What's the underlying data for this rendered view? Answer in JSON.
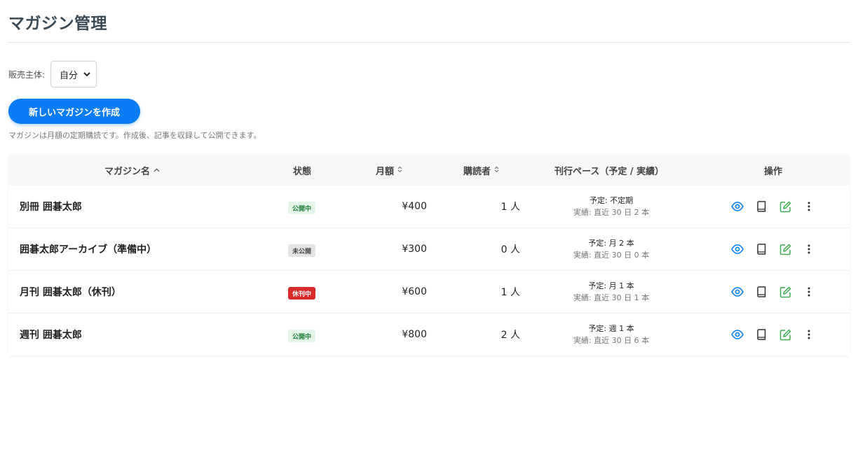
{
  "page": {
    "title": "マガジン管理"
  },
  "seller": {
    "label": "販売主体:",
    "selected": "自分"
  },
  "actions": {
    "create_label": "新しいマガジンを作成",
    "help_text": "マガジンは月額の定期購読です。作成後、記事を収録して公開できます。"
  },
  "table": {
    "headers": {
      "name": "マガジン名",
      "status": "状態",
      "price": "月額",
      "subscribers": "購読者",
      "pace": "刊行ペース（予定 / 実績）",
      "ops": "操作"
    },
    "rows": [
      {
        "name": "別冊 囲碁太郎",
        "status": "公開中",
        "status_kind": "published",
        "price": "¥400",
        "subscribers": "1 人",
        "plan": "予定: 不定期",
        "actual": "実績: 直近 30 日 2 本"
      },
      {
        "name": "囲碁太郎アーカイブ（準備中）",
        "status": "未公開",
        "status_kind": "draft",
        "price": "¥300",
        "subscribers": "0 人",
        "plan": "予定: 月 2 本",
        "actual": "実績: 直近 30 日 0 本"
      },
      {
        "name": "月刊 囲碁太郎（休刊）",
        "status": "休刊中",
        "status_kind": "paused",
        "price": "¥600",
        "subscribers": "1 人",
        "plan": "予定: 月 1 本",
        "actual": "実績: 直近 30 日 1 本"
      },
      {
        "name": "週刊 囲碁太郎",
        "status": "公開中",
        "status_kind": "published",
        "price": "¥800",
        "subscribers": "2 人",
        "plan": "予定: 週 1 本",
        "actual": "実績: 直近 30 日 6 本"
      }
    ],
    "row_actions": [
      "eye-icon",
      "book-icon",
      "edit-icon",
      "more-vertical-icon"
    ]
  },
  "colors": {
    "accent": "#0a7cf5",
    "published_bg": "#e3f6e8",
    "published_text": "#1e7d35",
    "paused_bg": "#d72a2a",
    "draft_bg": "#e4e4e4",
    "edit_icon": "#3daa4f",
    "view_icon": "#0a7cf5"
  }
}
